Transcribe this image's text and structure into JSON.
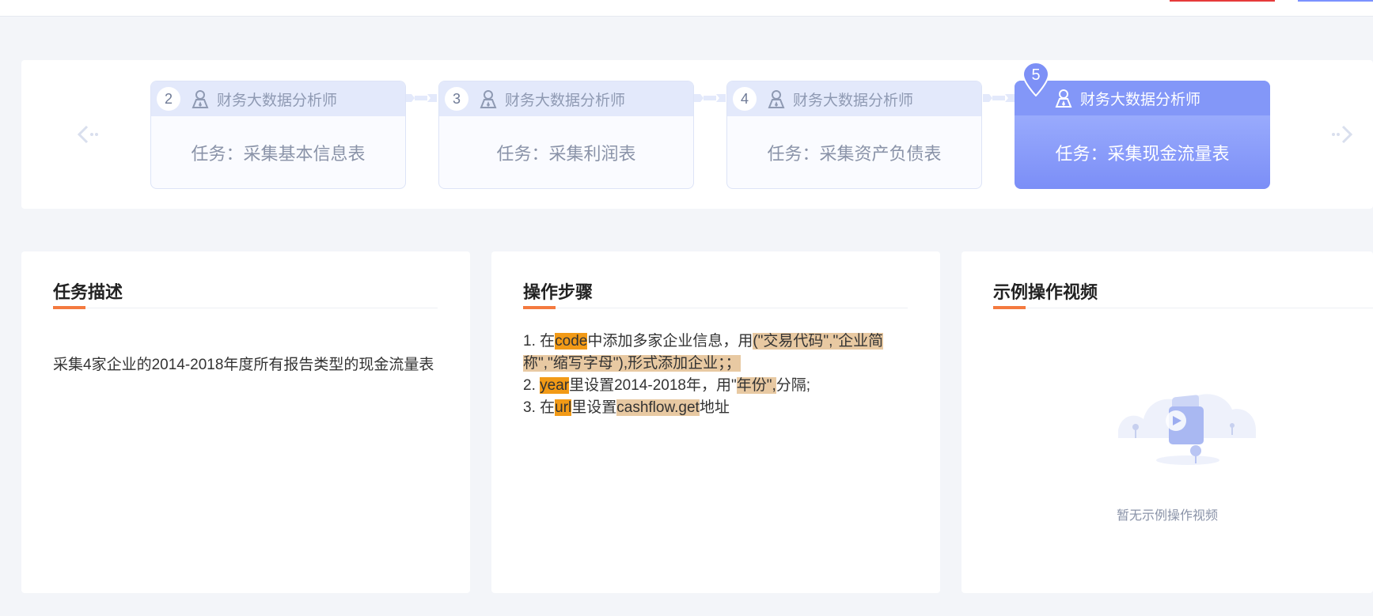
{
  "steps": [
    {
      "num": "2",
      "role": "财务大数据分析师",
      "task": "任务：采集基本信息表",
      "active": false
    },
    {
      "num": "3",
      "role": "财务大数据分析师",
      "task": "任务：采集利润表",
      "active": false
    },
    {
      "num": "4",
      "role": "财务大数据分析师",
      "task": "任务：采集资产负债表",
      "active": false
    },
    {
      "num": "5",
      "role": "财务大数据分析师",
      "task": "任务：采集现金流量表",
      "active": true
    }
  ],
  "description": {
    "title": "任务描述",
    "text": "采集4家企业的2014-2018年度所有报告类型的现金流量表"
  },
  "operations": {
    "title": "操作步骤",
    "line1": {
      "a": "1. 在",
      "b": "code",
      "c": "中添加多家企业信息，用",
      "d": "(\"交易代码\",\"企业简称\",\"缩写字母\"),形式添加企业；；"
    },
    "line2": {
      "a": "2. ",
      "b": "year",
      "c": "里设置2014-2018年，用\"",
      "d": "年份\",",
      "e": "分隔;"
    },
    "line3": {
      "a": "3. 在",
      "b": "url",
      "c": "里设置",
      "d": "cashflow.get",
      "e": "地址"
    }
  },
  "video": {
    "title": "示例操作视频",
    "empty_text": "暂无示例操作视频"
  },
  "colors": {
    "accent": "#f47a3f",
    "active_step": "#8397f8",
    "highlight_primary": "#f29a16",
    "highlight_secondary": "#e8c9a2"
  }
}
